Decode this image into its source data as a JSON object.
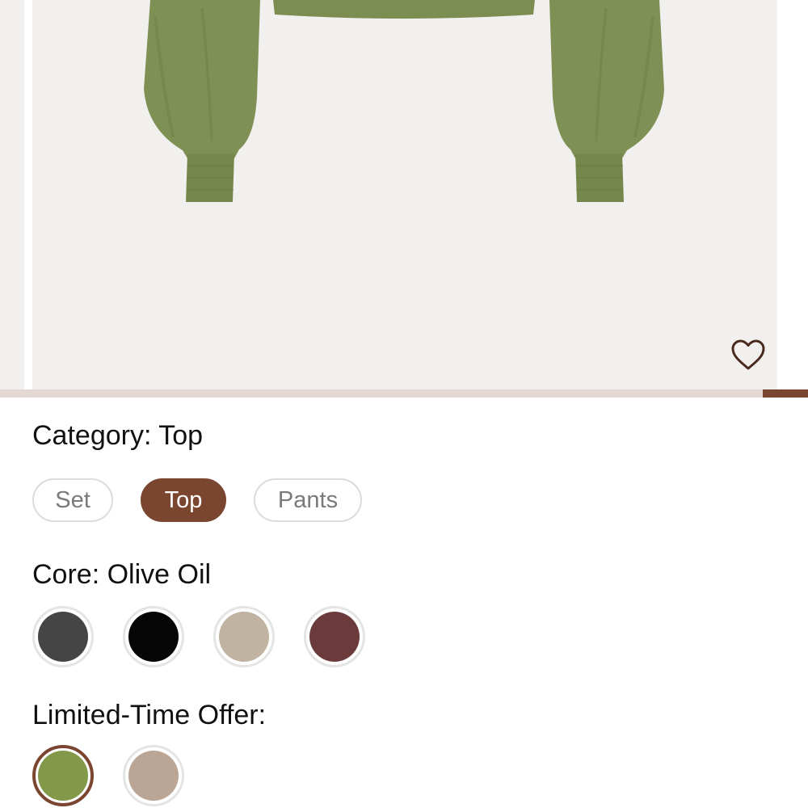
{
  "product_image": {
    "alt": "Olive green long-sleeve cropped top"
  },
  "favorite": {
    "icon": "heart-outline-icon",
    "color": "#4a2a1e"
  },
  "gallery_progress": {
    "position_fraction": 0.944,
    "length_fraction": 0.056,
    "track_color": "#e3d8d2",
    "fill_color": "#7a4630"
  },
  "category": {
    "label": "Category: Top",
    "options": [
      {
        "label": "Set",
        "selected": false
      },
      {
        "label": "Top",
        "selected": true
      },
      {
        "label": "Pants",
        "selected": false
      }
    ]
  },
  "core": {
    "label": "Core: Olive Oil",
    "swatches": [
      {
        "color": "#454545",
        "selected": false
      },
      {
        "color": "#050505",
        "selected": false
      },
      {
        "color": "#c0b3a1",
        "selected": false
      },
      {
        "color": "#6b3b3b",
        "selected": false
      }
    ]
  },
  "limited": {
    "label": "Limited-Time Offer:",
    "swatches": [
      {
        "color": "#84984a",
        "selected": true
      },
      {
        "color": "#bba696",
        "selected": false
      }
    ]
  },
  "accent_color": "#7a4630"
}
